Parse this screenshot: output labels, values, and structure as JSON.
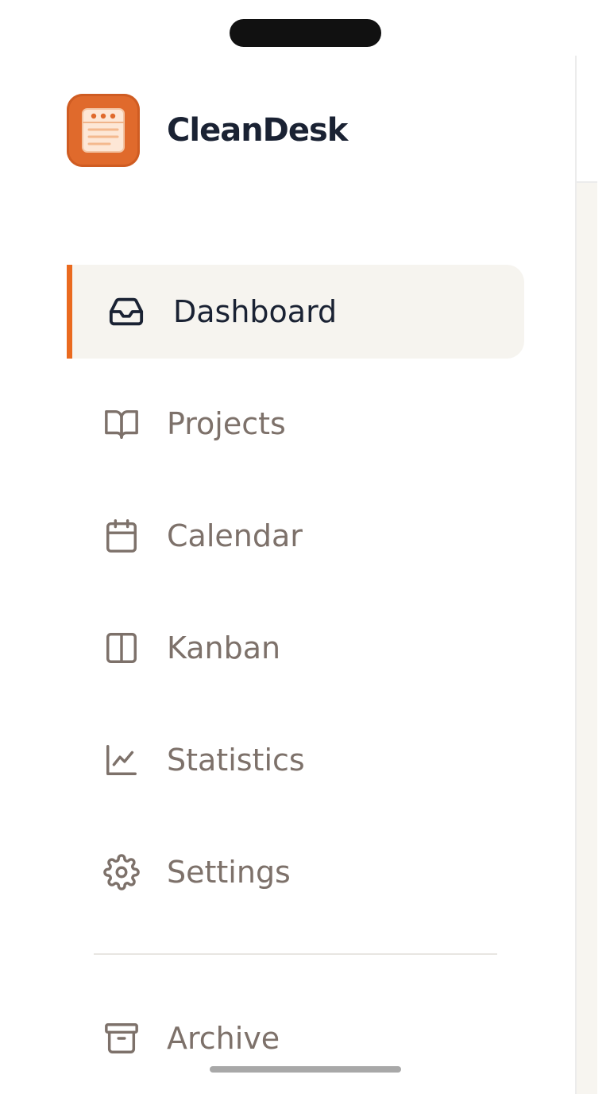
{
  "app": {
    "name": "CleanDesk",
    "accent_color": "#ea6a1f",
    "logo_icon": "notepad-icon"
  },
  "sidebar": {
    "items": [
      {
        "label": "Dashboard",
        "icon": "inbox-icon",
        "active": true
      },
      {
        "label": "Projects",
        "icon": "book-open-icon",
        "active": false
      },
      {
        "label": "Calendar",
        "icon": "calendar-icon",
        "active": false
      },
      {
        "label": "Kanban",
        "icon": "columns-icon",
        "active": false
      },
      {
        "label": "Statistics",
        "icon": "line-chart-icon",
        "active": false
      },
      {
        "label": "Settings",
        "icon": "gear-icon",
        "active": false
      }
    ],
    "footer_items": [
      {
        "label": "Archive",
        "icon": "archive-box-icon"
      }
    ]
  }
}
